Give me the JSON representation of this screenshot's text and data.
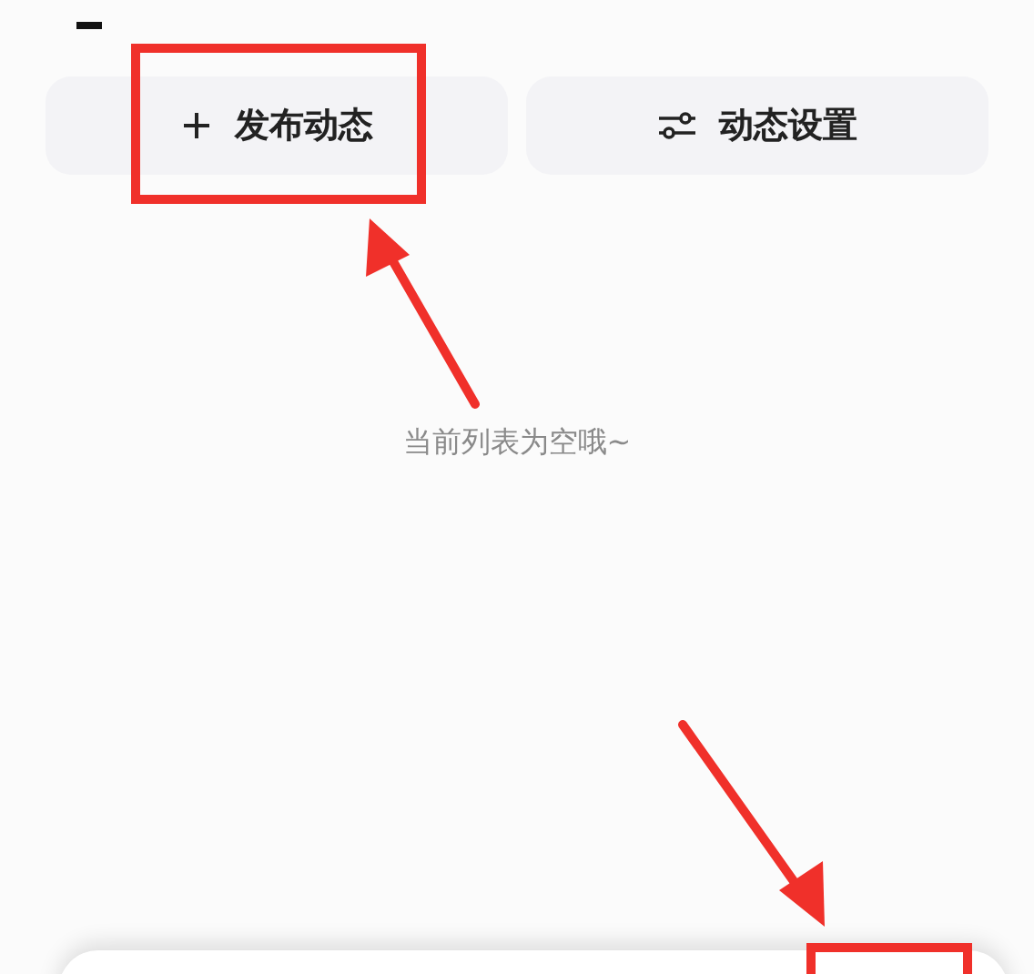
{
  "actions": [
    {
      "kind": "add",
      "label": "发布动态"
    },
    {
      "kind": "settings",
      "label": "动态设置"
    }
  ],
  "empty_text": "当前列表为空哦~"
}
